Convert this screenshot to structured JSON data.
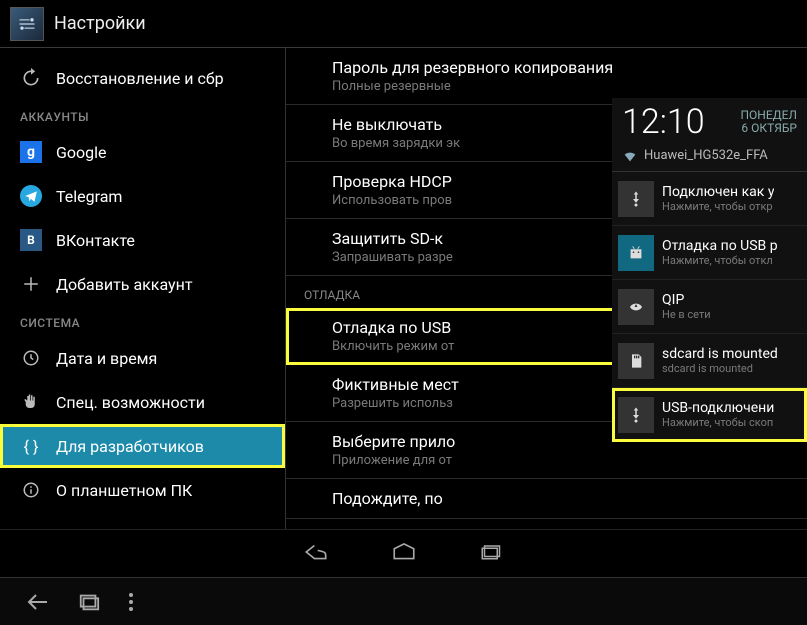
{
  "header": {
    "title": "Настройки"
  },
  "sidebar": {
    "restore": "Восстановление и сбр",
    "section_accounts": "Аккаунты",
    "accounts": [
      {
        "label": "Google"
      },
      {
        "label": "Telegram"
      },
      {
        "label": "ВКонтакте"
      },
      {
        "label": "Добавить аккаунт"
      }
    ],
    "section_system": "Система",
    "system": [
      {
        "label": "Дата и время"
      },
      {
        "label": "Спец. возможности"
      },
      {
        "label": "Для разработчиков"
      },
      {
        "label": "О планшетном ПК"
      }
    ]
  },
  "main": {
    "items": [
      {
        "title": "Пароль для резервного копирования",
        "sub": "Полные резервные"
      },
      {
        "title": "Не выключать",
        "sub": "Во время зарядки эк"
      },
      {
        "title": "Проверка HDCP",
        "sub": "Использовать пров"
      },
      {
        "title": "Защитить SD-к",
        "sub": "Запрашивать разре"
      }
    ],
    "section_debug": "Отладка",
    "debug_items": [
      {
        "title": "Отладка по USB",
        "sub": "Включить режим от"
      },
      {
        "title": "Фиктивные мест",
        "sub": "Разрешить использ"
      },
      {
        "title": "Выберите прило",
        "sub": "Приложение для от"
      },
      {
        "title": "Подождите, по",
        "sub": ""
      }
    ]
  },
  "notif": {
    "time": "12:10",
    "day": "ПОНЕДЕЛ",
    "date": "6 ОКТЯБР",
    "wifi": "Huawei_HG532e_FFA",
    "items": [
      {
        "title": "Подключен как у",
        "sub": "Нажмите, чтобы откр"
      },
      {
        "title": "Отладка по USB р",
        "sub": "Нажмите, чтобы откл"
      },
      {
        "title": "QIP",
        "sub": "Не в сети"
      },
      {
        "title": "sdcard is mounted",
        "sub": "sdcard is mounted"
      },
      {
        "title": "USB-подключени",
        "sub": "Нажмите, чтобы скоп"
      }
    ]
  }
}
